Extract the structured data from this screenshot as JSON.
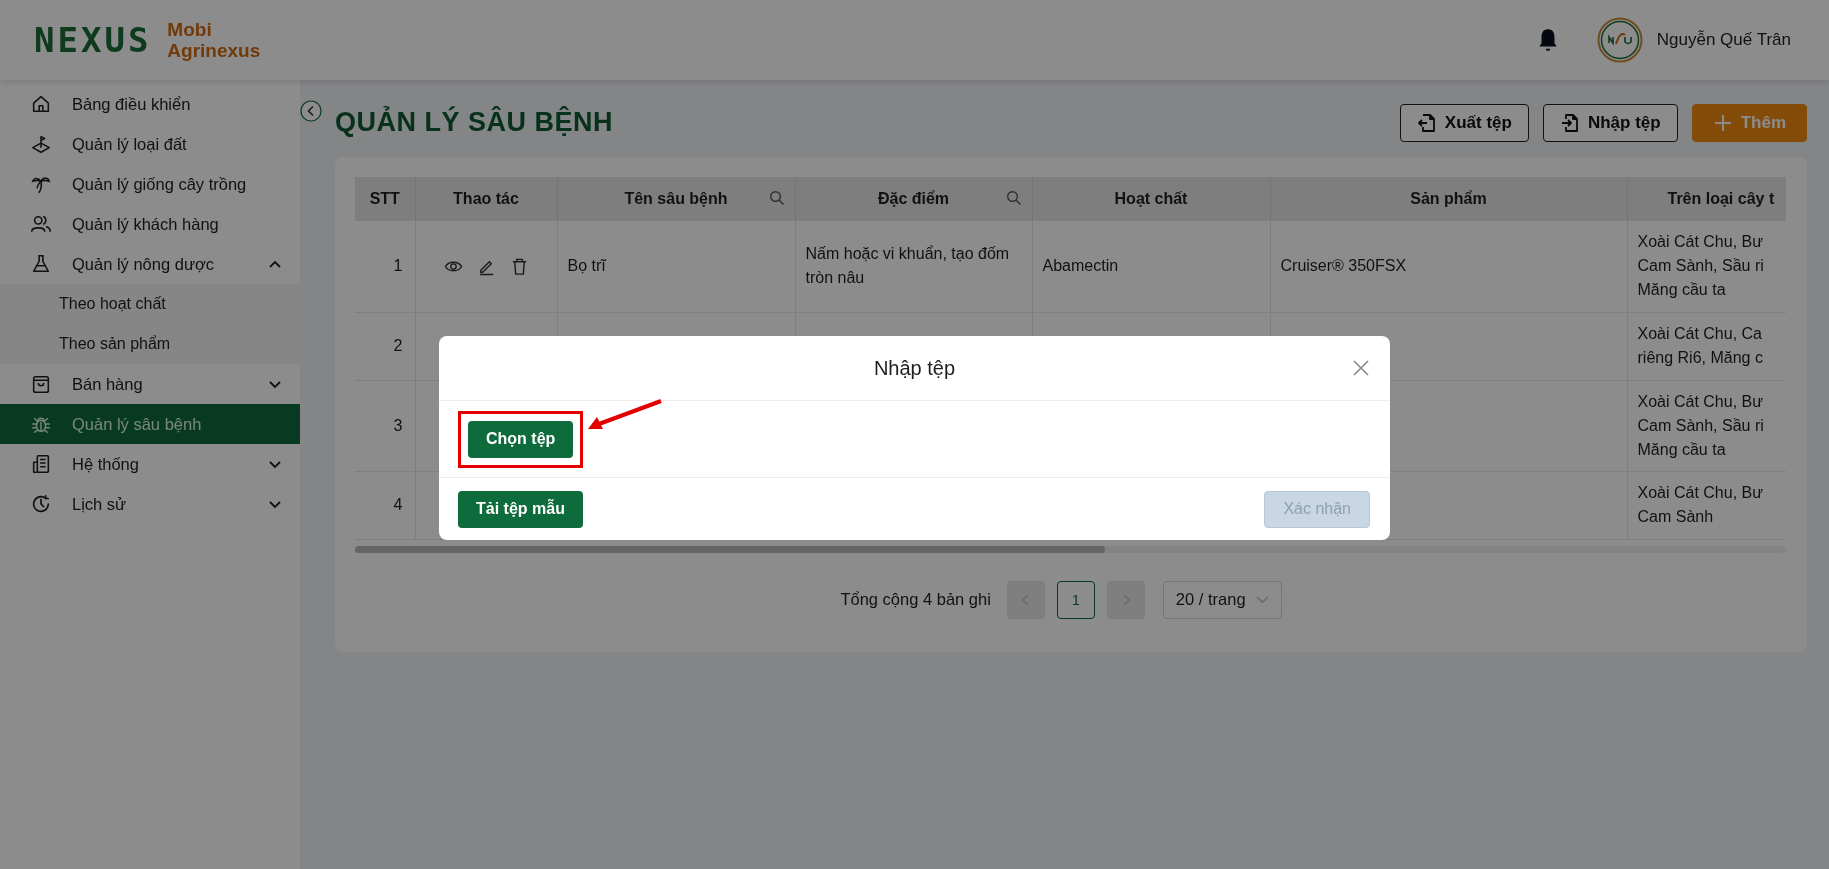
{
  "logo": {
    "wordmark": "NEXUS",
    "line_1": "Mobi",
    "line_2": "Agrinexus"
  },
  "user": {
    "name": "Nguyễn Quế Trân"
  },
  "sidebar": {
    "items": [
      {
        "label": "Bảng điều khiển",
        "kind": "home",
        "selected": false
      },
      {
        "label": "Quản lý loại đất",
        "kind": "land",
        "selected": false
      },
      {
        "label": "Quản lý giống cây trồng",
        "kind": "plant",
        "selected": false
      },
      {
        "label": "Quản lý khách hàng",
        "kind": "users",
        "selected": false
      },
      {
        "label": "Quản lý nông dược",
        "kind": "flask",
        "selected": false,
        "expanded": true,
        "children": [
          {
            "label": "Theo hoạt chất",
            "selected": false
          },
          {
            "label": "Theo sản phẩm",
            "selected": false
          }
        ]
      },
      {
        "label": "Bán hàng",
        "kind": "bag",
        "selected": false,
        "expanded": false
      },
      {
        "label": "Quản lý sâu bệnh",
        "kind": "bug",
        "selected": true
      },
      {
        "label": "Hệ thống",
        "kind": "building",
        "selected": false,
        "expanded": false
      },
      {
        "label": "Lịch sử",
        "kind": "clock",
        "selected": false,
        "expanded": false
      }
    ]
  },
  "page_title": "QUẢN LÝ SÂU BỆNH",
  "actions": [
    {
      "label": "Xuất tệp",
      "kind": "export"
    },
    {
      "label": "Nhập tệp",
      "kind": "import"
    },
    {
      "label": "Thêm",
      "kind": "add"
    }
  ],
  "table": {
    "columns": [
      {
        "label": "STT",
        "searchable": false
      },
      {
        "label": "Thao tác",
        "searchable": false
      },
      {
        "label": "Tên sâu bệnh",
        "searchable": true
      },
      {
        "label": "Đặc điểm",
        "searchable": true
      },
      {
        "label": "Hoạt chất",
        "searchable": false
      },
      {
        "label": "Sản phẩm",
        "searchable": false
      },
      {
        "label": "Trên loại cây t",
        "searchable": false
      }
    ],
    "rows": [
      {
        "stt": "1",
        "actions": true,
        "name": "Bọ trĩ",
        "traits": "Nấm hoặc vi khuẩn, tạo đốm tròn nâu",
        "active": "Abamectin",
        "product": "Cruiser® 350FSX",
        "crops": [
          "Xoài Cát Chu, Bư",
          "Cam Sành, Sầu ri",
          "Măng cầu ta"
        ]
      },
      {
        "stt": "2",
        "crops": [
          "Xoài Cát Chu, Ca",
          "riêng Ri6, Măng c"
        ]
      },
      {
        "stt": "3",
        "crops": [
          "Xoài Cát Chu, Bư",
          "Cam Sành, Sầu ri",
          "Măng cầu ta"
        ]
      },
      {
        "stt": "4",
        "crops": [
          "Xoài Cát Chu, Bư",
          "Cam Sành"
        ]
      }
    ]
  },
  "pagination": {
    "total": "Tổng cộng 4 bản ghi",
    "prev_disabled": true,
    "next_disabled": true,
    "pages": [
      {
        "label": "1",
        "selected": true
      }
    ],
    "page_size": "20 / trang"
  },
  "modal": {
    "title": "Nhập tệp",
    "choose_button": "Chọn tệp",
    "template_button": "Tải tệp mẫu",
    "confirm": {
      "label": "Xác nhận",
      "disabled": true
    }
  }
}
